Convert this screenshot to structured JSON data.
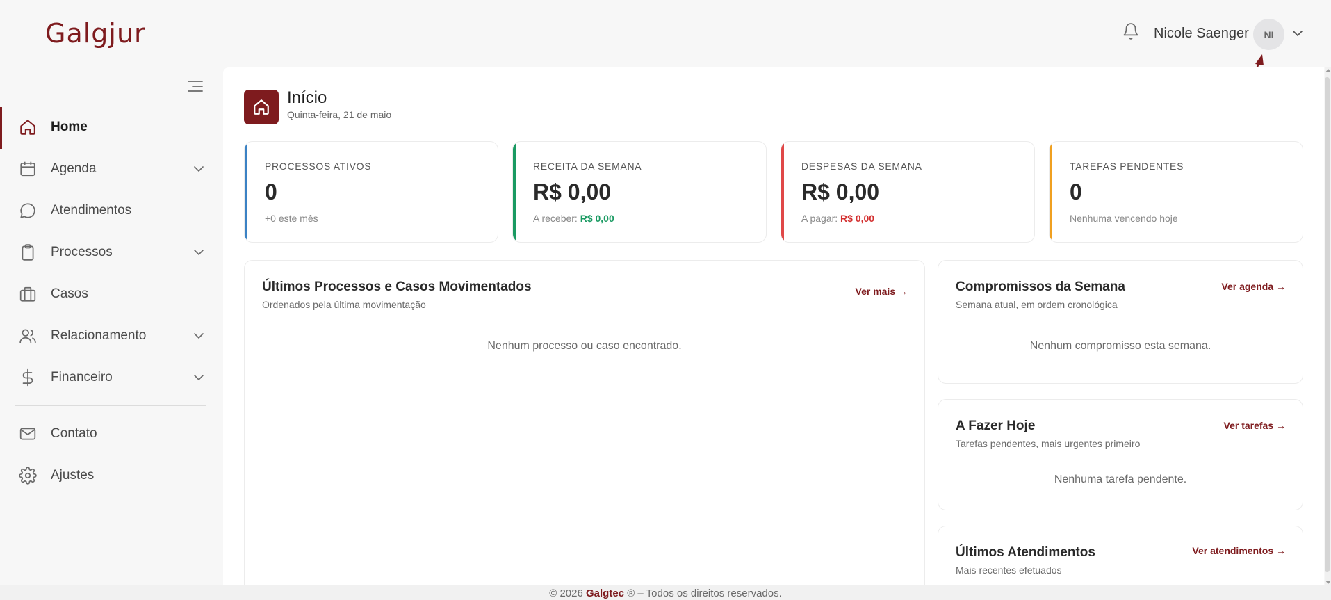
{
  "app": {
    "logo": "Galgjur"
  },
  "header": {
    "user_name": "Nicole Saenger",
    "avatar_initials": "NI"
  },
  "sidebar": {
    "items": [
      {
        "label": "Home",
        "icon": "home-icon",
        "active": true,
        "has_submenu": false
      },
      {
        "label": "Agenda",
        "icon": "calendar-icon",
        "has_submenu": true
      },
      {
        "label": "Atendimentos",
        "icon": "chat-bubble-icon",
        "has_submenu": false
      },
      {
        "label": "Processos",
        "icon": "clipboard-icon",
        "has_submenu": true
      },
      {
        "label": "Casos",
        "icon": "briefcase-icon",
        "has_submenu": false
      },
      {
        "label": "Relacionamento",
        "icon": "users-icon",
        "has_submenu": true
      },
      {
        "label": "Financeiro",
        "icon": "dollar-icon",
        "has_submenu": true
      },
      {
        "label": "Contato",
        "icon": "mail-icon",
        "has_submenu": false
      },
      {
        "label": "Ajustes",
        "icon": "gear-icon",
        "has_submenu": false
      }
    ]
  },
  "page": {
    "title": "Início",
    "subtitle": "Quinta-feira, 21 de maio"
  },
  "stats": [
    {
      "label": "PROCESSOS ATIVOS",
      "value": "0",
      "sub": "+0 este mês",
      "accent": "#3b82c4"
    },
    {
      "label": "RECEITA DA SEMANA",
      "value": "R$ 0,00",
      "sub_prefix": "A receber:",
      "sub_amount": "R$ 0,00",
      "accent": "#1a9a62"
    },
    {
      "label": "DESPESAS DA SEMANA",
      "value": "R$ 0,00",
      "sub_prefix": "A pagar:",
      "sub_amount": "R$ 0,00",
      "accent": "#e04848"
    },
    {
      "label": "TAREFAS PENDENTES",
      "value": "0",
      "sub": "Nenhuma vencendo hoje",
      "accent": "#f0a020"
    }
  ],
  "cards": {
    "processos": {
      "title": "Últimos Processos e Casos Movimentados",
      "subtitle": "Ordenados pela última movimentação",
      "link": "Ver mais →",
      "empty": "Nenhum processo ou caso encontrado."
    },
    "compromissos": {
      "title": "Compromissos da Semana",
      "subtitle": "Semana atual, em ordem cronológica",
      "link": "Ver agenda →",
      "empty": "Nenhum compromisso esta semana."
    },
    "afazer": {
      "title": "A Fazer Hoje",
      "subtitle": "Tarefas pendentes, mais urgentes primeiro",
      "link": "Ver tarefas →",
      "empty": "Nenhuma tarefa pendente."
    },
    "atendimentos": {
      "title": "Últimos Atendimentos",
      "subtitle": "Mais recentes efetuados",
      "link": "Ver atendimentos →"
    }
  },
  "footer": {
    "prefix": "© 2026",
    "brand": "Galgtec",
    "suffix": "® – Todos os direitos reservados."
  },
  "colors": {
    "brand": "#7e1b1e"
  }
}
